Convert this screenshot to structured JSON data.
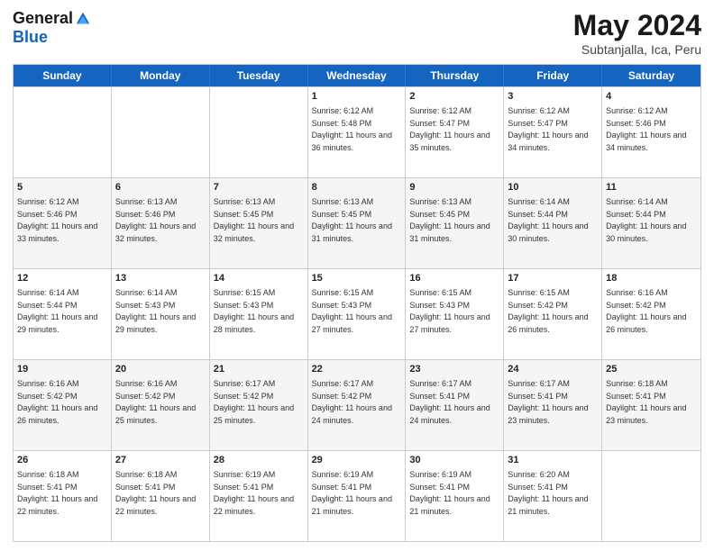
{
  "logo": {
    "general": "General",
    "blue": "Blue"
  },
  "header": {
    "month": "May 2024",
    "location": "Subtanjalla, Ica, Peru"
  },
  "weekdays": [
    "Sunday",
    "Monday",
    "Tuesday",
    "Wednesday",
    "Thursday",
    "Friday",
    "Saturday"
  ],
  "weeks": [
    {
      "alt": false,
      "cells": [
        {
          "day": "",
          "info": ""
        },
        {
          "day": "",
          "info": ""
        },
        {
          "day": "",
          "info": ""
        },
        {
          "day": "1",
          "info": "Sunrise: 6:12 AM\nSunset: 5:48 PM\nDaylight: 11 hours and 36 minutes."
        },
        {
          "day": "2",
          "info": "Sunrise: 6:12 AM\nSunset: 5:47 PM\nDaylight: 11 hours and 35 minutes."
        },
        {
          "day": "3",
          "info": "Sunrise: 6:12 AM\nSunset: 5:47 PM\nDaylight: 11 hours and 34 minutes."
        },
        {
          "day": "4",
          "info": "Sunrise: 6:12 AM\nSunset: 5:46 PM\nDaylight: 11 hours and 34 minutes."
        }
      ]
    },
    {
      "alt": true,
      "cells": [
        {
          "day": "5",
          "info": "Sunrise: 6:12 AM\nSunset: 5:46 PM\nDaylight: 11 hours and 33 minutes."
        },
        {
          "day": "6",
          "info": "Sunrise: 6:13 AM\nSunset: 5:46 PM\nDaylight: 11 hours and 32 minutes."
        },
        {
          "day": "7",
          "info": "Sunrise: 6:13 AM\nSunset: 5:45 PM\nDaylight: 11 hours and 32 minutes."
        },
        {
          "day": "8",
          "info": "Sunrise: 6:13 AM\nSunset: 5:45 PM\nDaylight: 11 hours and 31 minutes."
        },
        {
          "day": "9",
          "info": "Sunrise: 6:13 AM\nSunset: 5:45 PM\nDaylight: 11 hours and 31 minutes."
        },
        {
          "day": "10",
          "info": "Sunrise: 6:14 AM\nSunset: 5:44 PM\nDaylight: 11 hours and 30 minutes."
        },
        {
          "day": "11",
          "info": "Sunrise: 6:14 AM\nSunset: 5:44 PM\nDaylight: 11 hours and 30 minutes."
        }
      ]
    },
    {
      "alt": false,
      "cells": [
        {
          "day": "12",
          "info": "Sunrise: 6:14 AM\nSunset: 5:44 PM\nDaylight: 11 hours and 29 minutes."
        },
        {
          "day": "13",
          "info": "Sunrise: 6:14 AM\nSunset: 5:43 PM\nDaylight: 11 hours and 29 minutes."
        },
        {
          "day": "14",
          "info": "Sunrise: 6:15 AM\nSunset: 5:43 PM\nDaylight: 11 hours and 28 minutes."
        },
        {
          "day": "15",
          "info": "Sunrise: 6:15 AM\nSunset: 5:43 PM\nDaylight: 11 hours and 27 minutes."
        },
        {
          "day": "16",
          "info": "Sunrise: 6:15 AM\nSunset: 5:43 PM\nDaylight: 11 hours and 27 minutes."
        },
        {
          "day": "17",
          "info": "Sunrise: 6:15 AM\nSunset: 5:42 PM\nDaylight: 11 hours and 26 minutes."
        },
        {
          "day": "18",
          "info": "Sunrise: 6:16 AM\nSunset: 5:42 PM\nDaylight: 11 hours and 26 minutes."
        }
      ]
    },
    {
      "alt": true,
      "cells": [
        {
          "day": "19",
          "info": "Sunrise: 6:16 AM\nSunset: 5:42 PM\nDaylight: 11 hours and 26 minutes."
        },
        {
          "day": "20",
          "info": "Sunrise: 6:16 AM\nSunset: 5:42 PM\nDaylight: 11 hours and 25 minutes."
        },
        {
          "day": "21",
          "info": "Sunrise: 6:17 AM\nSunset: 5:42 PM\nDaylight: 11 hours and 25 minutes."
        },
        {
          "day": "22",
          "info": "Sunrise: 6:17 AM\nSunset: 5:42 PM\nDaylight: 11 hours and 24 minutes."
        },
        {
          "day": "23",
          "info": "Sunrise: 6:17 AM\nSunset: 5:41 PM\nDaylight: 11 hours and 24 minutes."
        },
        {
          "day": "24",
          "info": "Sunrise: 6:17 AM\nSunset: 5:41 PM\nDaylight: 11 hours and 23 minutes."
        },
        {
          "day": "25",
          "info": "Sunrise: 6:18 AM\nSunset: 5:41 PM\nDaylight: 11 hours and 23 minutes."
        }
      ]
    },
    {
      "alt": false,
      "cells": [
        {
          "day": "26",
          "info": "Sunrise: 6:18 AM\nSunset: 5:41 PM\nDaylight: 11 hours and 22 minutes."
        },
        {
          "day": "27",
          "info": "Sunrise: 6:18 AM\nSunset: 5:41 PM\nDaylight: 11 hours and 22 minutes."
        },
        {
          "day": "28",
          "info": "Sunrise: 6:19 AM\nSunset: 5:41 PM\nDaylight: 11 hours and 22 minutes."
        },
        {
          "day": "29",
          "info": "Sunrise: 6:19 AM\nSunset: 5:41 PM\nDaylight: 11 hours and 21 minutes."
        },
        {
          "day": "30",
          "info": "Sunrise: 6:19 AM\nSunset: 5:41 PM\nDaylight: 11 hours and 21 minutes."
        },
        {
          "day": "31",
          "info": "Sunrise: 6:20 AM\nSunset: 5:41 PM\nDaylight: 11 hours and 21 minutes."
        },
        {
          "day": "",
          "info": ""
        }
      ]
    }
  ]
}
